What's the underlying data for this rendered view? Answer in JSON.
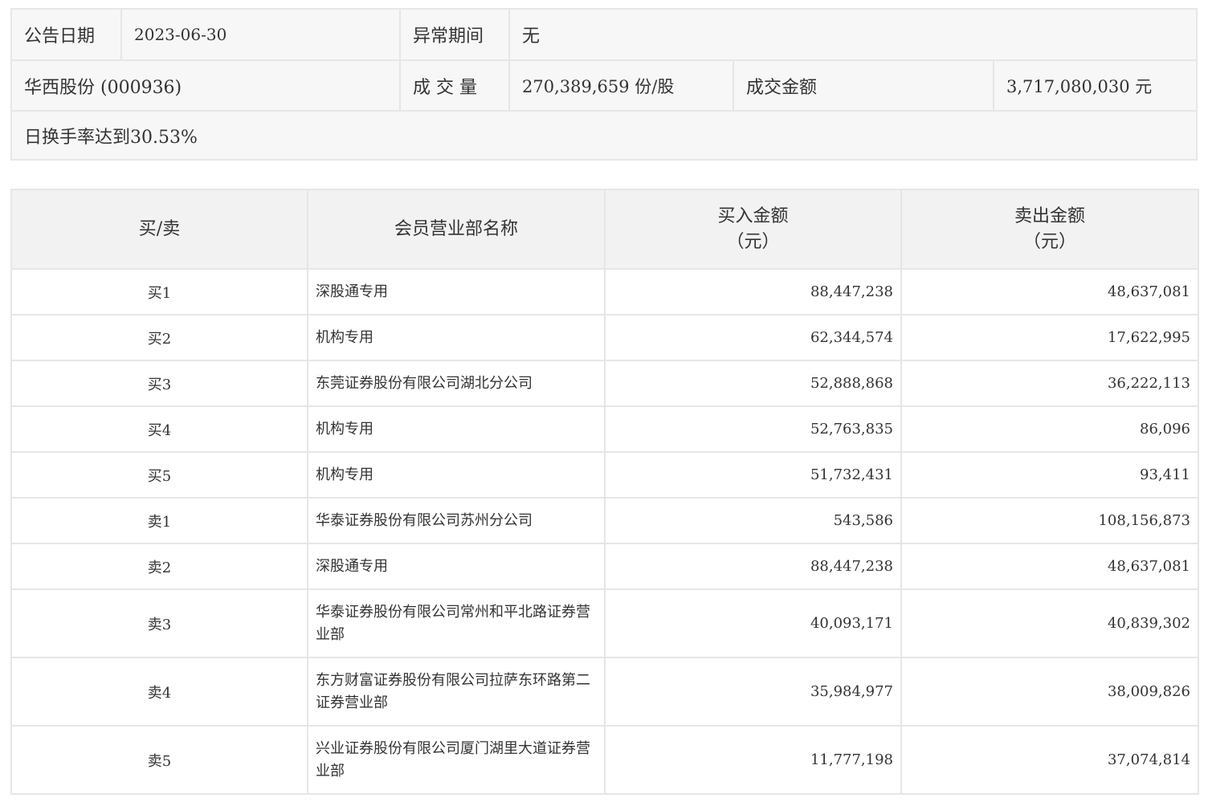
{
  "info": {
    "announce_date_label": "公告日期",
    "announce_date_value": "2023-06-30",
    "abnormal_period_label": "异常期间",
    "abnormal_period_value": "无",
    "stock_name": "华西股份 (000936)",
    "volume_label": "成 交 量",
    "volume_value": "270,389,659 份/股",
    "amount_label": "成交金额",
    "amount_value": "3,717,080,030 元",
    "turnover_note": "日换手率达到30.53%"
  },
  "table": {
    "headers": {
      "direction": "买/卖",
      "member": "会员营业部名称",
      "buy_line1": "买入金额",
      "buy_line2": "（元）",
      "sell_line1": "卖出金额",
      "sell_line2": "（元）"
    },
    "rows": [
      {
        "dir": "买1",
        "name": "深股通专用",
        "buy": "88,447,238",
        "sell": "48,637,081"
      },
      {
        "dir": "买2",
        "name": "机构专用",
        "buy": "62,344,574",
        "sell": "17,622,995"
      },
      {
        "dir": "买3",
        "name": "东莞证券股份有限公司湖北分公司",
        "buy": "52,888,868",
        "sell": "36,222,113"
      },
      {
        "dir": "买4",
        "name": "机构专用",
        "buy": "52,763,835",
        "sell": "86,096"
      },
      {
        "dir": "买5",
        "name": "机构专用",
        "buy": "51,732,431",
        "sell": "93,411"
      },
      {
        "dir": "卖1",
        "name": "华泰证券股份有限公司苏州分公司",
        "buy": "543,586",
        "sell": "108,156,873"
      },
      {
        "dir": "卖2",
        "name": "深股通专用",
        "buy": "88,447,238",
        "sell": "48,637,081"
      },
      {
        "dir": "卖3",
        "name": "华泰证券股份有限公司常州和平北路证券营业部",
        "buy": "40,093,171",
        "sell": "40,839,302"
      },
      {
        "dir": "卖4",
        "name": "东方财富证券股份有限公司拉萨东环路第二证券营业部",
        "buy": "35,984,977",
        "sell": "38,009,826"
      },
      {
        "dir": "卖5",
        "name": "兴业证券股份有限公司厦门湖里大道证券营业部",
        "buy": "11,777,198",
        "sell": "37,074,814"
      }
    ]
  }
}
